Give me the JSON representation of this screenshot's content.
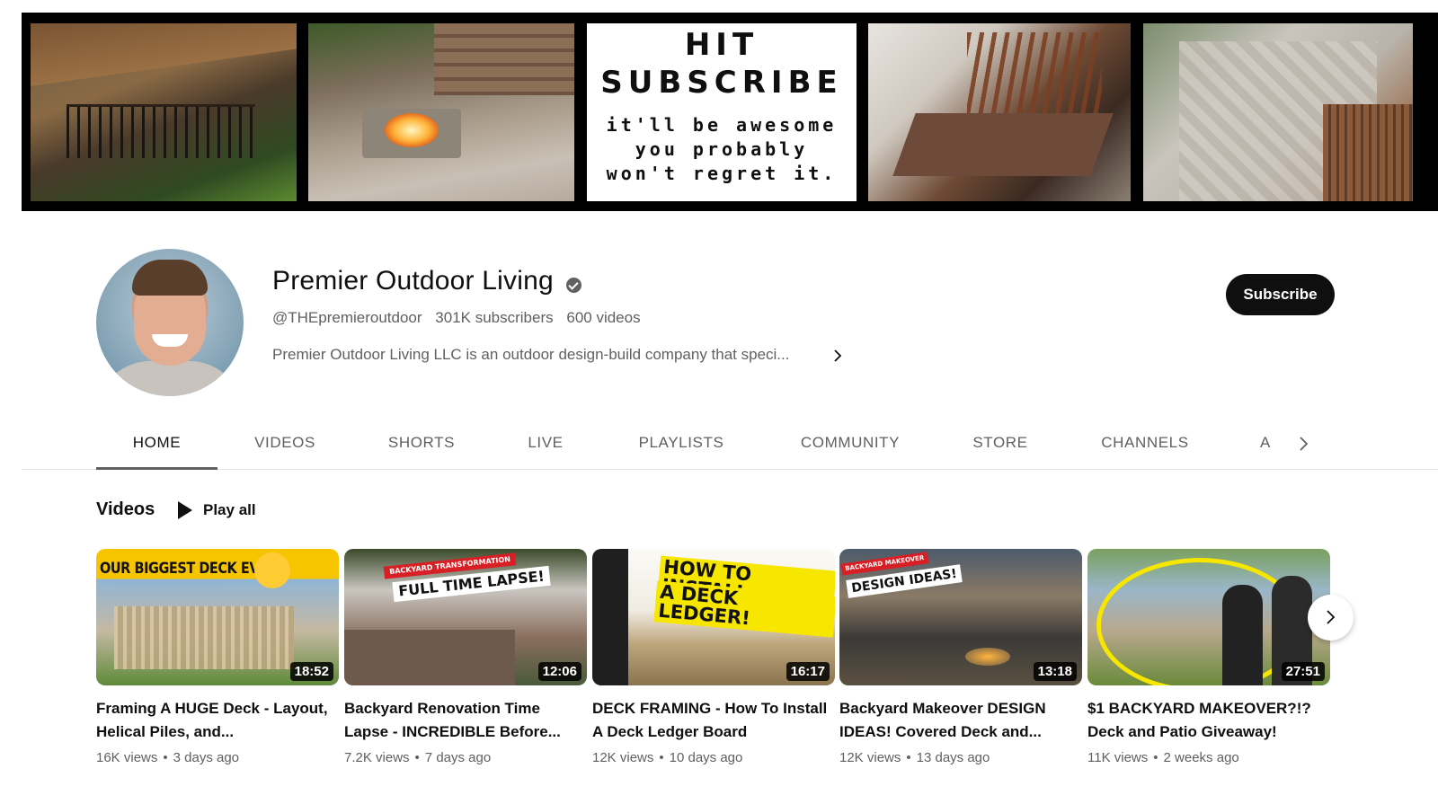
{
  "banner": {
    "headline_line1": "HIT",
    "headline_line2": "SUBSCRIBE",
    "tagline_line1": "it'll be awesome",
    "tagline_line2": "you probably",
    "tagline_line3": "won't regret it."
  },
  "channel": {
    "name": "Premier Outdoor Living",
    "handle": "@THEpremieroutdoor",
    "subscribers": "301K subscribers",
    "videos_count": "600 videos",
    "description": "Premier Outdoor Living LLC is an outdoor design-build company that speci...",
    "subscribe_label": "Subscribe",
    "verified_icon": "verified-check-icon"
  },
  "tabs": [
    {
      "label": "HOME",
      "active": true
    },
    {
      "label": "VIDEOS",
      "active": false
    },
    {
      "label": "SHORTS",
      "active": false
    },
    {
      "label": "LIVE",
      "active": false
    },
    {
      "label": "PLAYLISTS",
      "active": false
    },
    {
      "label": "COMMUNITY",
      "active": false
    },
    {
      "label": "STORE",
      "active": false
    },
    {
      "label": "CHANNELS",
      "active": false
    },
    {
      "label": "A",
      "active": false
    }
  ],
  "shelf": {
    "title": "Videos",
    "play_all_label": "Play all",
    "videos": [
      {
        "thumb_text": "OUR BIGGEST DECK EVER",
        "duration": "18:52",
        "title": "Framing A HUGE Deck - Layout, Helical Piles, and...",
        "views": "16K views",
        "age": "3 days ago"
      },
      {
        "thumb_small": "BACKYARD TRANSFORMATION",
        "thumb_text": "FULL TIME LAPSE!",
        "duration": "12:06",
        "title": "Backyard Renovation Time Lapse - INCREDIBLE Before...",
        "views": "7.2K views",
        "age": "7 days ago"
      },
      {
        "thumb_text_line1": "HOW TO INSTALL",
        "thumb_text_line2": "A DECK LEDGER!",
        "duration": "16:17",
        "title": "DECK FRAMING - How To Install A Deck Ledger Board",
        "views": "12K views",
        "age": "10 days ago"
      },
      {
        "thumb_small": "BACKYARD MAKEOVER",
        "thumb_text": "DESIGN IDEAS!",
        "duration": "13:18",
        "title": "Backyard Makeover DESIGN IDEAS! Covered Deck and...",
        "views": "12K views",
        "age": "13 days ago"
      },
      {
        "duration": "27:51",
        "title": "$1 BACKYARD MAKEOVER?!? Deck and Patio Giveaway!",
        "views": "11K views",
        "age": "2 weeks ago"
      }
    ]
  },
  "colors": {
    "text_primary": "#0f0f0f",
    "text_secondary": "#606060",
    "thumb_yellow": "#f7c400",
    "thumb_red": "#d81f26"
  }
}
